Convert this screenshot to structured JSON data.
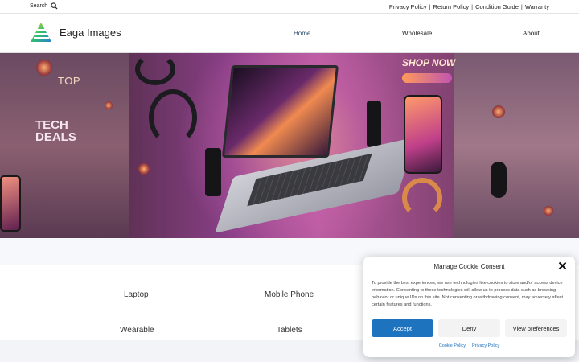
{
  "topbar": {
    "search_label": "Search",
    "policy_links": [
      "Privacy Policy",
      "Return Policy",
      "Condition Guide",
      "Warranty"
    ],
    "separator": "|"
  },
  "header": {
    "brand": "Eaga Images",
    "nav": {
      "home": "Home",
      "wholesale": "Wholesale",
      "about": "About"
    }
  },
  "hero": {
    "top_text": "TOP",
    "tech_text_line1": "TECH",
    "tech_text_line2": "DEALS",
    "shop_text": "SHOP NOW"
  },
  "categories": [
    "Laptop",
    "Mobile Phone",
    "Wearable",
    "Tablets"
  ],
  "cookie_banner": {
    "title": "Manage Cookie Consent",
    "body": "To provide the best experiences, we use technologies like cookies to store and/or access device information. Consenting to these technologies will allow us to process data such as browsing behavior or unique IDs on this site. Not consenting or withdrawing consent, may adversely affect certain features and functions.",
    "accept": "Accept",
    "deny": "Deny",
    "preferences": "View preferences",
    "cookie_policy": "Cookie Policy",
    "privacy_policy": "Privacy Policy"
  },
  "colors": {
    "accent": "#1e73be",
    "nav_active": "#2a4a6b"
  }
}
